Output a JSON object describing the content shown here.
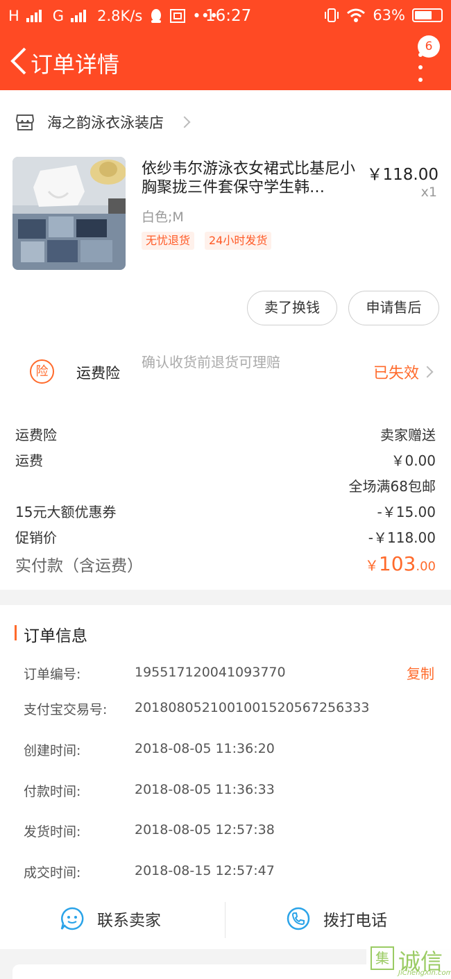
{
  "status_bar": {
    "signal_left": "H",
    "signal_mid": "G",
    "speed": "2.8K/s",
    "time": "16:27",
    "battery": "63%"
  },
  "nav": {
    "title": "订单详情",
    "badge_count": "6"
  },
  "shop": {
    "name": "海之韵泳衣泳装店"
  },
  "product": {
    "title": "依纱韦尔游泳衣女裙式比基尼小胸聚拢三件套保守学生韩…",
    "price": "￥118.00",
    "quantity": "x1",
    "sku": "白色;M",
    "tags": [
      "无忧退货",
      "24小时发货"
    ]
  },
  "actions": {
    "sell_label": "卖了换钱",
    "aftersale_label": "申请售后"
  },
  "insurance": {
    "icon_char": "险",
    "title": "运费险",
    "desc": "确认收货前退货可理赔",
    "status": "已失效"
  },
  "fees": {
    "shipping_insurance_label": "运费险",
    "shipping_insurance_value": "卖家赠送",
    "shipping_label": "运费",
    "shipping_value": "￥0.00",
    "shipping_note": "全场满68包邮",
    "coupon_label": "15元大额优惠券",
    "coupon_value": "-￥15.00",
    "promo_label": "促销价",
    "promo_value": "-￥118.00",
    "total_label": "实付款（含运费）",
    "total_symbol": "￥",
    "total_int": "103",
    "total_dec": ".00"
  },
  "order_info": {
    "section_title": "订单信息",
    "copy_label": "复制",
    "rows": [
      {
        "label": "订单编号:",
        "value": "195517120041093770"
      },
      {
        "label": "支付宝交易号:",
        "value": "2018080521001001520567256333"
      },
      {
        "label": "创建时间:",
        "value": "2018-08-05 11:36:20"
      },
      {
        "label": "付款时间:",
        "value": "2018-08-05 11:36:33"
      },
      {
        "label": "发货时间:",
        "value": "2018-08-05 12:57:38"
      },
      {
        "label": "成交时间:",
        "value": "2018-08-15 12:57:47"
      }
    ]
  },
  "contact": {
    "seller_label": "联系卖家",
    "phone_label": "拨打电话"
  },
  "watermark": {
    "box_char": "集",
    "text": "诚信",
    "sub": "JiChengXin.com"
  },
  "colors": {
    "brand": "#ff4a24",
    "accent": "#ff6a2b",
    "contact_icon": "#2aa3e8"
  }
}
